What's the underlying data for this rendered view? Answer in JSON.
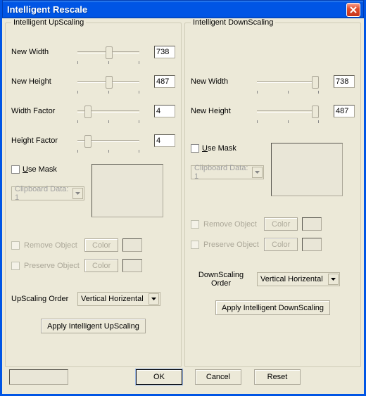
{
  "window": {
    "title": "Intelligent Rescale"
  },
  "up": {
    "legend": "Intelligent UpScaling",
    "width_label": "New Width",
    "width_value": "738",
    "height_label": "New Height",
    "height_value": "487",
    "wfactor_label": "Width Factor",
    "wfactor_value": "4",
    "hfactor_label": "Height Factor",
    "hfactor_value": "4",
    "usemask_label": "Use Mask",
    "clipboard_label": "Clipboard Data: 1",
    "remove_label": "Remove Object",
    "preserve_label": "Preserve Object",
    "color_label": "Color",
    "order_label": "UpScaling Order",
    "order_value": "Vertical Horizental",
    "apply_label": "Apply Intelligent UpScaling"
  },
  "down": {
    "legend": "Intelligent DownScaling",
    "width_label": "New Width",
    "width_value": "738",
    "height_label": "New Height",
    "height_value": "487",
    "usemask_label": "Use Mask",
    "clipboard_label": "Clipboard Data: 1",
    "remove_label": "Remove Object",
    "preserve_label": "Preserve Object",
    "color_label": "Color",
    "order_label_1": "DownScaling",
    "order_label_2": "Order",
    "order_value": "Vertical Horizental",
    "apply_label": "Apply Intelligent DownScaling"
  },
  "buttons": {
    "ok": "OK",
    "cancel": "Cancel",
    "reset": "Reset"
  }
}
